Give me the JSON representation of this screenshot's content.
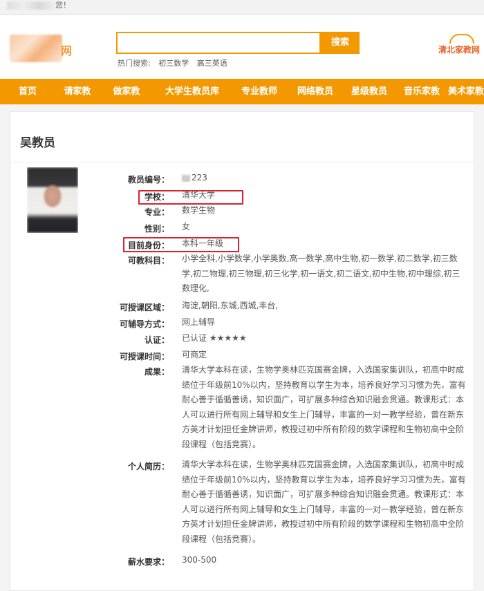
{
  "topbar": {
    "greeting_suffix": "您！"
  },
  "header": {
    "logo_text": "网",
    "search": {
      "placeholder": "",
      "button_label": "搜索"
    },
    "hot_search": {
      "label": "热门搜索:",
      "items": [
        "初三数学",
        "高三英语"
      ]
    },
    "brand": "清北家教网"
  },
  "nav": [
    "首页",
    "请家教",
    "做家教",
    "大学生教员库",
    "专业教师",
    "网络教员",
    "星级教员",
    "音乐家教",
    "美术家教"
  ],
  "profile": {
    "name": "吴教员",
    "fields": [
      {
        "label": "教员编号：",
        "value": "223"
      },
      {
        "label": "学校：",
        "value": "清华大学"
      },
      {
        "label": "专业：",
        "value": "数学生物"
      },
      {
        "label": "性别：",
        "value": "女"
      },
      {
        "label": "目前身份：",
        "value": "本科一年级"
      },
      {
        "label": "可教科目：",
        "value": "小学全科,小学数学,小学奥数,高一数学,高中生物,初一数学,初二数学,初三数学,初二物理,初三物理,初三化学,初一语文,初二语文,初中生物,初中理综,初三数理化,"
      },
      {
        "label": "可授课区域：",
        "value": "海淀,朝阳,东城,西城,丰台,"
      },
      {
        "label": "可辅导方式：",
        "value": "网上辅导"
      },
      {
        "label": "认证：",
        "value": "已认证 ★★★★★"
      },
      {
        "label": "可授课时间：",
        "value": "可商定"
      },
      {
        "label": "成果：",
        "value": "清华大学本科在读，生物学奥林匹克国赛金牌，入选国家集训队，初高中时成绩位于年级前10%以内，坚持教育以学生为本，培养良好学习习惯为先，富有耐心善于循循善诱，知识面广，可扩展多种综合知识融会贯通。教课形式：本人可以进行所有网上辅导和女生上门辅导，丰富的一对一教学经验，曾在新东方英才计划担任金牌讲师，教授过初中所有阶段的数学课程和生物初高中全阶段课程（包括竞赛）。"
      },
      {
        "label": "个人简历：",
        "value": "清华大学本科在读，生物学奥林匹克国赛金牌，入选国家集训队，初高中时成绩位于年级前10%以内，坚持教育以学生为本，培养良好学习习惯为先，富有耐心善于循循善诱，知识面广，可扩展多种综合知识融会贯通。教课形式：本人可以进行所有网上辅导和女生上门辅导，丰富的一对一教学经验，曾在新东方英才计划担任金牌讲师，教授过初中所有阶段的数学课程和生物初高中全阶段课程（包括竞赛）。"
      },
      {
        "label": "薪水要求：",
        "value": "300-500"
      }
    ]
  },
  "colors": {
    "accent": "#f39800",
    "highlight": "#d9232e"
  }
}
